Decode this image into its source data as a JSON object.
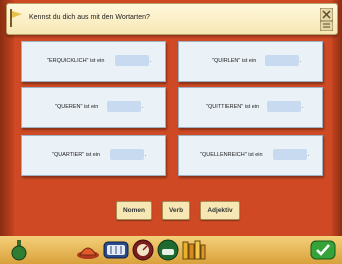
{
  "question": "Kennst du dich aus mit den Wortarten?",
  "cards": [
    {
      "word": "\"ERQUICKLICH\" ist ein",
      "end": "."
    },
    {
      "word": "\"QUIRLEN\" ist ein",
      "end": "."
    },
    {
      "word": "\"QUEREN\" ist ein",
      "end": "."
    },
    {
      "word": "\"QUITTIEREN\" ist ein",
      "end": "."
    },
    {
      "word": "\"QUARTIER\" ist ein",
      "end": "."
    },
    {
      "word": "\"QUELLENREICH\" ist ein",
      "end": "."
    }
  ],
  "answers": {
    "noun": "Nomen",
    "verb": "Verb",
    "adjective": "Adjektiv"
  },
  "toolbar": {
    "icons": [
      "potion-icon",
      "cap-icon",
      "counter-icon",
      "gauge-icon",
      "helmet-icon",
      "books-icon",
      "checkmark-icon"
    ]
  },
  "colors": {
    "wall": "#cf4a24",
    "card": "#eaf1f7",
    "blank": "#c8daf0",
    "banner": "#fff8dc"
  }
}
